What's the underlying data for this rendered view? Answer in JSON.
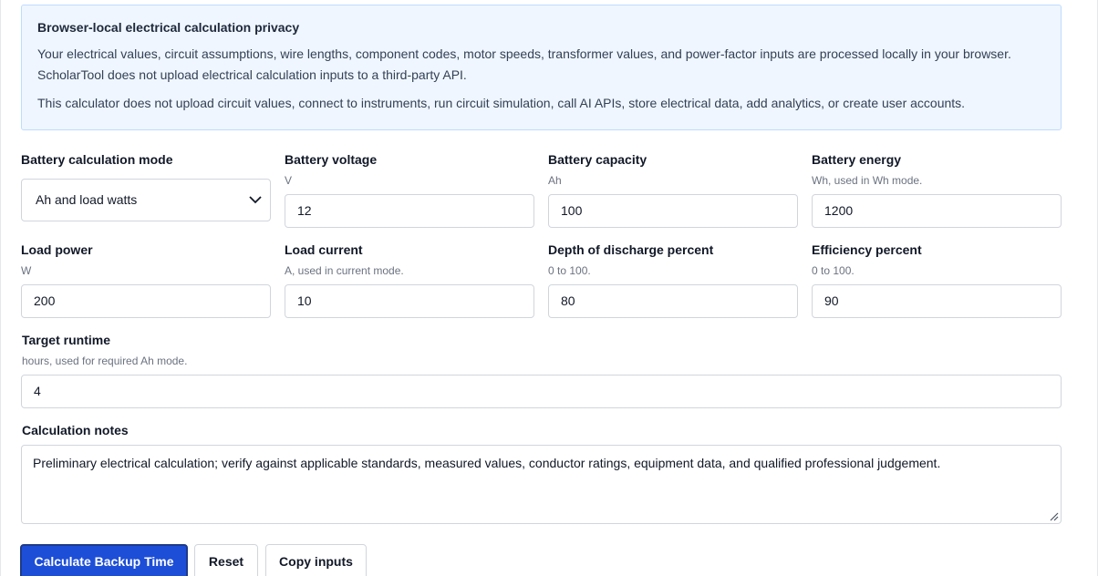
{
  "privacy": {
    "title": "Browser-local electrical calculation privacy",
    "paragraph_1": "Your electrical values, circuit assumptions, wire lengths, component codes, motor speeds, transformer values, and power-factor inputs are processed locally in your browser. ScholarTool does not upload electrical calculation inputs to a third-party API.",
    "paragraph_2": "This calculator does not upload circuit values, connect to instruments, run circuit simulation, call AI APIs, store electrical data, add analytics, or create user accounts."
  },
  "fields": {
    "mode": {
      "label": "Battery calculation mode",
      "selected": "Ah and load watts"
    },
    "voltage": {
      "label": "Battery voltage",
      "hint": "V",
      "value": "12"
    },
    "capacity": {
      "label": "Battery capacity",
      "hint": "Ah",
      "value": "100"
    },
    "energy": {
      "label": "Battery energy",
      "hint": "Wh, used in Wh mode.",
      "value": "1200"
    },
    "load_power": {
      "label": "Load power",
      "hint": "W",
      "value": "200"
    },
    "load_current": {
      "label": "Load current",
      "hint": "A, used in current mode.",
      "value": "10"
    },
    "dod": {
      "label": "Depth of discharge percent",
      "hint": "0 to 100.",
      "value": "80"
    },
    "efficiency": {
      "label": "Efficiency percent",
      "hint": "0 to 100.",
      "value": "90"
    },
    "runtime": {
      "label": "Target runtime",
      "hint": "hours, used for required Ah mode.",
      "value": "4"
    },
    "notes": {
      "label": "Calculation notes",
      "value": "Preliminary electrical calculation; verify against applicable standards, measured values, conductor ratings, equipment data, and qualified professional judgement."
    }
  },
  "buttons": {
    "calculate": "Calculate Backup Time",
    "reset": "Reset",
    "copy": "Copy inputs"
  },
  "colors": {
    "primary": "#1d4ed8",
    "privacy_bg": "#eff6ff"
  }
}
